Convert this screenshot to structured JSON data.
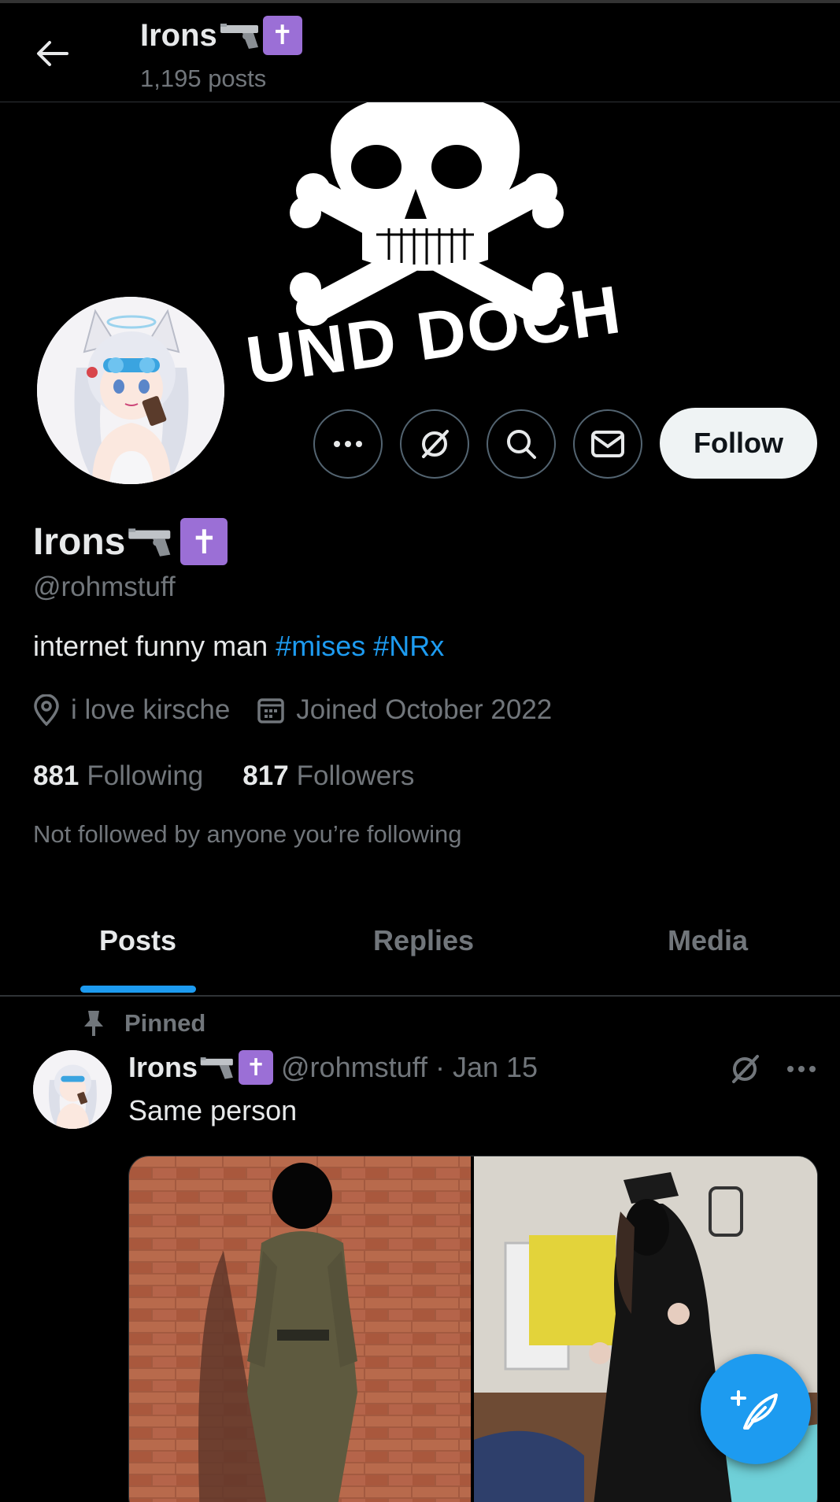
{
  "header": {
    "title": "Irons",
    "subtitle": "1,195 posts"
  },
  "banner": {
    "text": "UND DOCH"
  },
  "profile": {
    "name": "Irons",
    "handle": "@rohmstuff",
    "badge": "✝",
    "bio_text": "internet funny man",
    "bio_tags": [
      "#mises",
      "#NRx"
    ],
    "location": "i love kirsche",
    "joined": "Joined October 2022",
    "following_count": "881",
    "following_label": "Following",
    "followers_count": "817",
    "followers_label": "Followers",
    "not_followed": "Not followed by anyone you’re following"
  },
  "actions": {
    "follow_label": "Follow",
    "icons": [
      "more-icon",
      "grok-icon",
      "search-icon",
      "mail-icon"
    ]
  },
  "tabs": [
    {
      "label": "Posts",
      "active": true
    },
    {
      "label": "Replies",
      "active": false
    },
    {
      "label": "Media",
      "active": false
    }
  ],
  "pinned_post": {
    "pinned_label": "Pinned",
    "author_name": "Irons",
    "handle": "@rohmstuff",
    "separator": "·",
    "date": "Jan 15",
    "text": "Same person"
  },
  "colors": {
    "accent": "#1d9bf0",
    "badge": "#9b6fd6",
    "background": "#000000",
    "muted": "#71767b"
  }
}
